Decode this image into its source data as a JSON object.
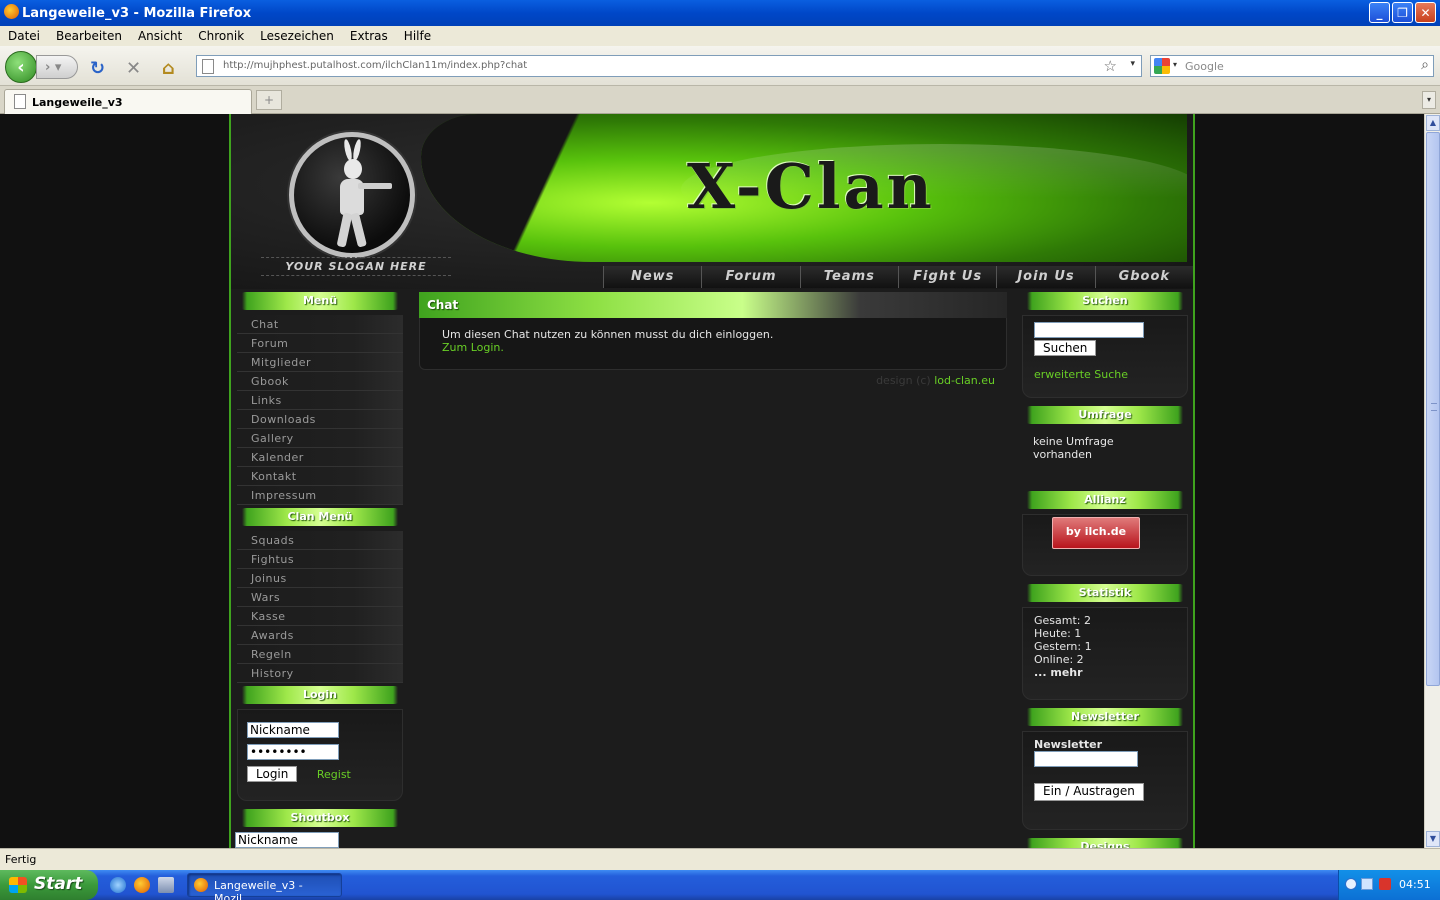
{
  "window": {
    "title": "Langeweile_v3 - Mozilla Firefox"
  },
  "menubar": [
    "Datei",
    "Bearbeiten",
    "Ansicht",
    "Chronik",
    "Lesezeichen",
    "Extras",
    "Hilfe"
  ],
  "toolbar": {
    "url": "http://mujhphest.putalhost.com/ilchClan11m/index.php?chat",
    "search_placeholder": "Google"
  },
  "tabs": [
    {
      "label": "Langeweile_v3"
    }
  ],
  "site": {
    "title": "X-Clan",
    "slogan": "YOUR SLOGAN HERE",
    "topnav": [
      "News",
      "Forum",
      "Teams",
      "Fight Us",
      "Join Us",
      "Gbook"
    ],
    "menu": {
      "title": "Menü",
      "items": [
        "Chat",
        "Forum",
        "Mitglieder",
        "Gbook",
        "Links",
        "Downloads",
        "Gallery",
        "Kalender",
        "Kontakt",
        "Impressum"
      ]
    },
    "clanmenu": {
      "title": "Clan Menü",
      "items": [
        "Squads",
        "Fightus",
        "Joinus",
        "Wars",
        "Kasse",
        "Awards",
        "Regeln",
        "History"
      ]
    },
    "login": {
      "title": "Login",
      "nickname": "Nickname",
      "password": "••••••••",
      "button": "Login",
      "register": "Regist"
    },
    "shoutbox": {
      "title": "Shoutbox",
      "nickname": "Nickname"
    },
    "chat": {
      "title": "Chat",
      "message": "Um diesen Chat nutzen zu können musst du dich einloggen.",
      "link": "Zum Login."
    },
    "credit": {
      "prefix": "design (c)",
      "link": "lod-clan.eu"
    },
    "search": {
      "title": "Suchen",
      "button": "Suchen",
      "advanced": "erweiterte Suche"
    },
    "poll": {
      "title": "Umfrage",
      "text": "keine Umfrage vorhanden"
    },
    "allianz": {
      "title": "Allianz",
      "badge": "by ilch.de"
    },
    "stats": {
      "title": "Statistik",
      "lines": [
        "Gesamt: 2",
        "Heute: 1",
        "Gestern: 1",
        "Online: 2"
      ],
      "more": "... mehr"
    },
    "newsletter": {
      "title": "Newsletter",
      "label": "Newsletter",
      "button": "Ein / Austragen"
    },
    "designs": {
      "title": "Designs"
    }
  },
  "status": {
    "text": "Fertig"
  },
  "taskbar": {
    "start": "Start",
    "item": "Langeweile_v3 - Mozil...",
    "clock": "04:51"
  }
}
